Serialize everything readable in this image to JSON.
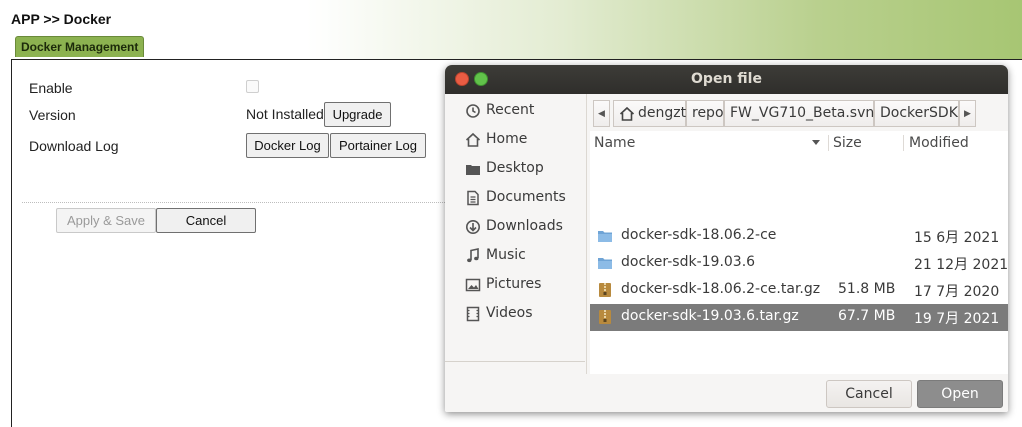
{
  "page": {
    "breadcrumb": "APP >> Docker",
    "tab": "Docker Management",
    "rows": {
      "enable_label": "Enable",
      "version_label": "Version",
      "version_status": "Not Installed",
      "download_log_label": "Download Log"
    },
    "buttons": {
      "upgrade": "Upgrade",
      "docker_log": "Docker Log",
      "portainer_log": "Portainer Log",
      "apply_save": "Apply & Save",
      "cancel": "Cancel"
    }
  },
  "dialog": {
    "title": "Open file",
    "places": [
      {
        "label": "Recent",
        "icon": "recent-icon"
      },
      {
        "label": "Home",
        "icon": "home-icon"
      },
      {
        "label": "Desktop",
        "icon": "desktop-icon"
      },
      {
        "label": "Documents",
        "icon": "documents-icon"
      },
      {
        "label": "Downloads",
        "icon": "downloads-icon"
      },
      {
        "label": "Music",
        "icon": "music-icon"
      },
      {
        "label": "Pictures",
        "icon": "pictures-icon"
      },
      {
        "label": "Videos",
        "icon": "videos-icon"
      }
    ],
    "path": [
      "dengzt",
      "repo",
      "FW_VG710_Beta.svn",
      "DockerSDK"
    ],
    "columns": {
      "name": "Name",
      "size": "Size",
      "modified": "Modified"
    },
    "files": [
      {
        "name": "docker-sdk-18.06.2-ce",
        "size": "",
        "modified": "15 6月 2021",
        "type": "folder"
      },
      {
        "name": "docker-sdk-19.03.6",
        "size": "",
        "modified": "21 12月 2021",
        "type": "folder"
      },
      {
        "name": "docker-sdk-18.06.2-ce.tar.gz",
        "size": "51.8 MB",
        "modified": "17 7月 2020",
        "type": "archive"
      },
      {
        "name": "docker-sdk-19.03.6.tar.gz",
        "size": "67.7 MB",
        "modified": "19 7月 2021",
        "type": "archive",
        "selected": true
      }
    ],
    "buttons": {
      "cancel": "Cancel",
      "open": "Open"
    }
  },
  "colors": {
    "tab_green": "#8cb250",
    "titlebar": "#3d3c38",
    "close": "#e95c43",
    "maximize": "#61c24a",
    "selection": "#7b7b7b",
    "folder": "#6fa4d6"
  }
}
